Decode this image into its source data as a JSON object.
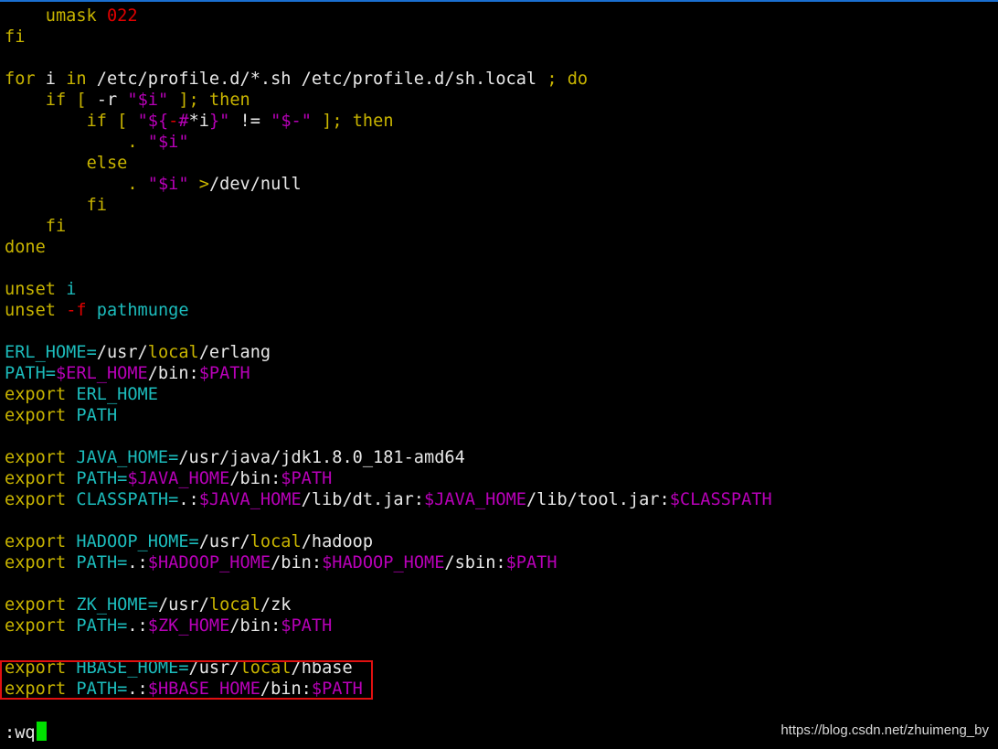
{
  "colors": {
    "background": "#000000",
    "keyword": "#c8b400",
    "number": "#e00000",
    "variable": "#1cbcbc",
    "expansion": "#b800b8",
    "text": "#e8e8e8",
    "highlight_box": "#e01010",
    "cursor": "#00e000"
  },
  "lines": [
    [
      {
        "t": "    "
      },
      {
        "t": "umask",
        "c": "yellow"
      },
      {
        "t": " "
      },
      {
        "t": "022",
        "c": "red"
      }
    ],
    [
      {
        "t": "fi",
        "c": "yellow"
      }
    ],
    [],
    [
      {
        "t": "for",
        "c": "yellow"
      },
      {
        "t": " i "
      },
      {
        "t": "in",
        "c": "yellow"
      },
      {
        "t": " /etc/profile.d/*.sh /etc/profile.d/sh.local "
      },
      {
        "t": ";",
        "c": "yellow"
      },
      {
        "t": " "
      },
      {
        "t": "do",
        "c": "yellow"
      }
    ],
    [
      {
        "t": "    "
      },
      {
        "t": "if",
        "c": "yellow"
      },
      {
        "t": " "
      },
      {
        "t": "[",
        "c": "yellow"
      },
      {
        "t": " -r "
      },
      {
        "t": "\"",
        "c": "magenta"
      },
      {
        "t": "$i",
        "c": "magenta"
      },
      {
        "t": "\"",
        "c": "magenta"
      },
      {
        "t": " "
      },
      {
        "t": "];",
        "c": "yellow"
      },
      {
        "t": " "
      },
      {
        "t": "then",
        "c": "yellow"
      }
    ],
    [
      {
        "t": "        "
      },
      {
        "t": "if",
        "c": "yellow"
      },
      {
        "t": " "
      },
      {
        "t": "[",
        "c": "yellow"
      },
      {
        "t": " "
      },
      {
        "t": "\"",
        "c": "magenta"
      },
      {
        "t": "${",
        "c": "magenta"
      },
      {
        "t": "-",
        "c": "red"
      },
      {
        "t": "#",
        "c": "magenta"
      },
      {
        "t": "*i"
      },
      {
        "t": "}",
        "c": "magenta"
      },
      {
        "t": "\"",
        "c": "magenta"
      },
      {
        "t": " != "
      },
      {
        "t": "\"",
        "c": "magenta"
      },
      {
        "t": "$-",
        "c": "magenta"
      },
      {
        "t": "\"",
        "c": "magenta"
      },
      {
        "t": " "
      },
      {
        "t": "];",
        "c": "yellow"
      },
      {
        "t": " "
      },
      {
        "t": "then",
        "c": "yellow"
      }
    ],
    [
      {
        "t": "            "
      },
      {
        "t": ".",
        "c": "yellow"
      },
      {
        "t": " "
      },
      {
        "t": "\"",
        "c": "magenta"
      },
      {
        "t": "$i",
        "c": "magenta"
      },
      {
        "t": "\"",
        "c": "magenta"
      }
    ],
    [
      {
        "t": "        "
      },
      {
        "t": "else",
        "c": "yellow"
      }
    ],
    [
      {
        "t": "            "
      },
      {
        "t": ".",
        "c": "yellow"
      },
      {
        "t": " "
      },
      {
        "t": "\"",
        "c": "magenta"
      },
      {
        "t": "$i",
        "c": "magenta"
      },
      {
        "t": "\"",
        "c": "magenta"
      },
      {
        "t": " "
      },
      {
        "t": ">",
        "c": "yellow"
      },
      {
        "t": "/dev/null"
      }
    ],
    [
      {
        "t": "        "
      },
      {
        "t": "fi",
        "c": "yellow"
      }
    ],
    [
      {
        "t": "    "
      },
      {
        "t": "fi",
        "c": "yellow"
      }
    ],
    [
      {
        "t": "done",
        "c": "yellow"
      }
    ],
    [],
    [
      {
        "t": "unset",
        "c": "yellow"
      },
      {
        "t": " "
      },
      {
        "t": "i",
        "c": "cyan"
      }
    ],
    [
      {
        "t": "unset",
        "c": "yellow"
      },
      {
        "t": " "
      },
      {
        "t": "-f",
        "c": "red"
      },
      {
        "t": " "
      },
      {
        "t": "pathmunge",
        "c": "cyan"
      }
    ],
    [],
    [
      {
        "t": "ERL_HOME",
        "c": "cyan"
      },
      {
        "t": "=",
        "c": "cyan"
      },
      {
        "t": "/usr/"
      },
      {
        "t": "local",
        "c": "yellow"
      },
      {
        "t": "/erlang"
      }
    ],
    [
      {
        "t": "PATH",
        "c": "cyan"
      },
      {
        "t": "=",
        "c": "cyan"
      },
      {
        "t": "$ERL_HOME",
        "c": "magenta"
      },
      {
        "t": "/bin:"
      },
      {
        "t": "$PATH",
        "c": "magenta"
      }
    ],
    [
      {
        "t": "export",
        "c": "yellow"
      },
      {
        "t": " "
      },
      {
        "t": "ERL_HOME",
        "c": "cyan"
      }
    ],
    [
      {
        "t": "export",
        "c": "yellow"
      },
      {
        "t": " "
      },
      {
        "t": "PATH",
        "c": "cyan"
      }
    ],
    [],
    [
      {
        "t": "export",
        "c": "yellow"
      },
      {
        "t": " "
      },
      {
        "t": "JAVA_HOME",
        "c": "cyan"
      },
      {
        "t": "=",
        "c": "cyan"
      },
      {
        "t": "/usr/java/jdk1.8.0_181-amd64"
      }
    ],
    [
      {
        "t": "export",
        "c": "yellow"
      },
      {
        "t": " "
      },
      {
        "t": "PATH",
        "c": "cyan"
      },
      {
        "t": "=",
        "c": "cyan"
      },
      {
        "t": "$JAVA_HOME",
        "c": "magenta"
      },
      {
        "t": "/bin:"
      },
      {
        "t": "$PATH",
        "c": "magenta"
      }
    ],
    [
      {
        "t": "export",
        "c": "yellow"
      },
      {
        "t": " "
      },
      {
        "t": "CLASSPATH",
        "c": "cyan"
      },
      {
        "t": "=",
        "c": "cyan"
      },
      {
        "t": ".:"
      },
      {
        "t": "$JAVA_HOME",
        "c": "magenta"
      },
      {
        "t": "/lib/dt.jar:"
      },
      {
        "t": "$JAVA_HOME",
        "c": "magenta"
      },
      {
        "t": "/lib/tool.jar:"
      },
      {
        "t": "$CLASSPATH",
        "c": "magenta"
      }
    ],
    [],
    [
      {
        "t": "export",
        "c": "yellow"
      },
      {
        "t": " "
      },
      {
        "t": "HADOOP_HOME",
        "c": "cyan"
      },
      {
        "t": "=",
        "c": "cyan"
      },
      {
        "t": "/usr/"
      },
      {
        "t": "local",
        "c": "yellow"
      },
      {
        "t": "/hadoop"
      }
    ],
    [
      {
        "t": "export",
        "c": "yellow"
      },
      {
        "t": " "
      },
      {
        "t": "PATH",
        "c": "cyan"
      },
      {
        "t": "=",
        "c": "cyan"
      },
      {
        "t": ".:"
      },
      {
        "t": "$HADOOP_HOME",
        "c": "magenta"
      },
      {
        "t": "/bin:"
      },
      {
        "t": "$HADOOP_HOME",
        "c": "magenta"
      },
      {
        "t": "/sbin:"
      },
      {
        "t": "$PATH",
        "c": "magenta"
      }
    ],
    [],
    [
      {
        "t": "export",
        "c": "yellow"
      },
      {
        "t": " "
      },
      {
        "t": "ZK_HOME",
        "c": "cyan"
      },
      {
        "t": "=",
        "c": "cyan"
      },
      {
        "t": "/usr/"
      },
      {
        "t": "local",
        "c": "yellow"
      },
      {
        "t": "/zk"
      }
    ],
    [
      {
        "t": "export",
        "c": "yellow"
      },
      {
        "t": " "
      },
      {
        "t": "PATH",
        "c": "cyan"
      },
      {
        "t": "=",
        "c": "cyan"
      },
      {
        "t": ".:"
      },
      {
        "t": "$ZK_HOME",
        "c": "magenta"
      },
      {
        "t": "/bin:"
      },
      {
        "t": "$PATH",
        "c": "magenta"
      }
    ],
    [],
    [
      {
        "t": "export",
        "c": "yellow"
      },
      {
        "t": " "
      },
      {
        "t": "HBASE_HOME",
        "c": "cyan"
      },
      {
        "t": "=",
        "c": "cyan"
      },
      {
        "t": "/usr/"
      },
      {
        "t": "local",
        "c": "yellow"
      },
      {
        "t": "/hbase"
      }
    ],
    [
      {
        "t": "export",
        "c": "yellow"
      },
      {
        "t": " "
      },
      {
        "t": "PATH",
        "c": "cyan"
      },
      {
        "t": "=",
        "c": "cyan"
      },
      {
        "t": ".:"
      },
      {
        "t": "$HBASE_HOME",
        "c": "magenta"
      },
      {
        "t": "/bin:"
      },
      {
        "t": "$PATH",
        "c": "magenta"
      }
    ]
  ],
  "command_line": ":wq",
  "watermark": "https://blog.csdn.net/zhuimeng_by"
}
